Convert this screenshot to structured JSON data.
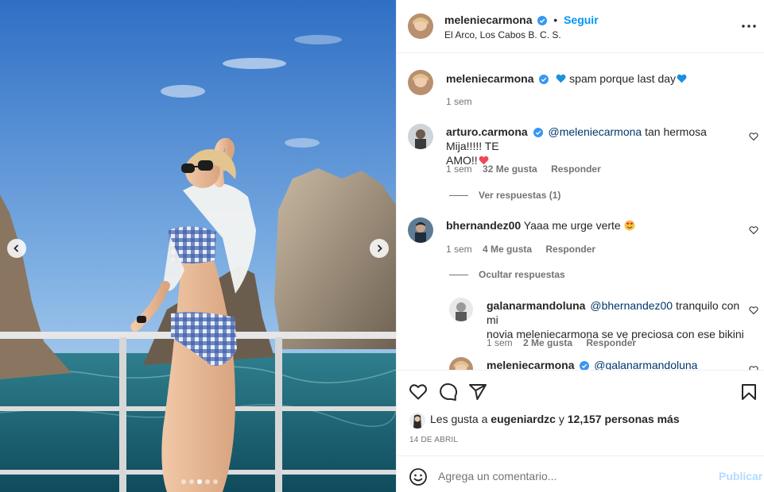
{
  "post": {
    "author": "meleniecarmona",
    "follow_label": "Seguir",
    "separator": "•",
    "location": "El Arco, Los Cabos B. C. S.",
    "more_icon": "more-horizontal-icon"
  },
  "photo": {
    "alt": "Woman in blue gingham bikini on boat railing near El Arco rock formations",
    "slides": 5,
    "active_slide": 2
  },
  "caption": {
    "user": "meleniecarmona",
    "text": "spam porque last day",
    "time": "1 sem"
  },
  "comments": [
    {
      "user": "arturo.carmona",
      "mention": "@meleniecarmona",
      "line1": " tan hermosa Mija!!!!! TE",
      "line2": "AMO!!",
      "time": "1 sem",
      "likes": "32 Me gusta",
      "reply_label": "Responder",
      "toggle": "Ver respuestas (1)"
    },
    {
      "user": "bhernandez00",
      "text": "Yaaa me urge verte",
      "time": "1 sem",
      "likes": "4 Me gusta",
      "reply_label": "Responder",
      "toggle": "Ocultar respuestas",
      "replies": [
        {
          "user": "galanarmandoluna",
          "mention": "@bhernandez00",
          "line1": " tranquilo con mi",
          "line2": "novia meleniecarmona se ve preciosa con ese bikini",
          "time": "1 sem",
          "likes": "2 Me gusta",
          "reply_label": "Responder"
        },
        {
          "user": "meleniecarmona",
          "mention": "@galanarmandoluna"
        }
      ]
    }
  ],
  "likes_bar": {
    "prefix": "Les gusta a ",
    "user": "eugeniardzc",
    "middle": " y ",
    "count": "12,157 personas más",
    "date": "14 DE ABRIL"
  },
  "composer": {
    "placeholder": "Agrega un comentario...",
    "publish_label": "Publicar"
  },
  "colors": {
    "link_blue": "#0095f6",
    "mention_blue": "#00376b",
    "muted": "#737373",
    "publish_disabled": "#b3dbff",
    "verified": "#3897f0",
    "heart_red": "#ed4956"
  }
}
